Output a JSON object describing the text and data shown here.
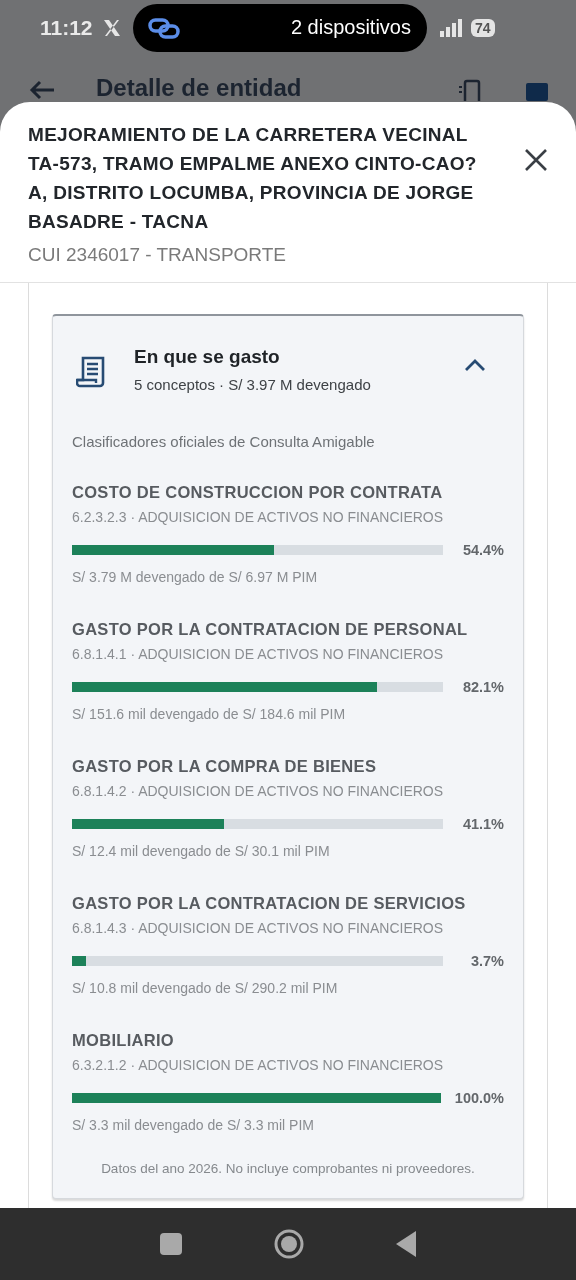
{
  "status_bar": {
    "time": "11:12",
    "pill_text": "2 dispositivos",
    "battery": "74"
  },
  "app_bar": {
    "title": "Detalle de entidad"
  },
  "sheet": {
    "title": "MEJORAMIENTO DE LA CARRETERA VECINAL TA-573, TRAMO EMPALME ANEXO CINTO-CAO?A, DISTRITO LOCUMBA, PROVINCIA DE JORGE BASADRE - TACNA",
    "subtitle": "CUI 2346017 - TRANSPORTE"
  },
  "spend_card": {
    "title": "En que se gasto",
    "summary": "5 conceptos · S/ 3.97 M devengado",
    "expanded": true,
    "caption": "Clasificadores oficiales de Consulta Amigable",
    "concepts": [
      {
        "name": "COSTO DE CONSTRUCCION POR CONTRATA",
        "code": "6.2.3.2.3 · ADQUISICION DE ACTIVOS NO FINANCIEROS",
        "level": 0.544,
        "percent": "54.4%",
        "detail": "S/ 3.79 M devengado de S/ 6.97 M PIM"
      },
      {
        "name": "GASTO POR LA CONTRATACION DE PERSONAL",
        "code": "6.8.1.4.1 · ADQUISICION DE ACTIVOS NO FINANCIEROS",
        "level": 0.821,
        "percent": "82.1%",
        "detail": "S/ 151.6 mil devengado de S/ 184.6 mil PIM"
      },
      {
        "name": "GASTO POR LA COMPRA DE BIENES",
        "code": "6.8.1.4.2 · ADQUISICION DE ACTIVOS NO FINANCIEROS",
        "level": 0.411,
        "percent": "41.1%",
        "detail": "S/ 12.4 mil devengado de S/ 30.1 mil PIM"
      },
      {
        "name": "GASTO POR LA CONTRATACION DE SERVICIOS",
        "code": "6.8.1.4.3 · ADQUISICION DE ACTIVOS NO FINANCIEROS",
        "level": 0.037,
        "percent": "3.7%",
        "detail": "S/ 10.8 mil devengado de S/ 290.2 mil PIM"
      },
      {
        "name": "MOBILIARIO",
        "code": "6.3.2.1.2 · ADQUISICION DE ACTIVOS NO FINANCIEROS",
        "level": 1.0,
        "percent": "100.0%",
        "detail": "S/ 3.3 mil devengado de S/ 3.3 mil PIM"
      }
    ],
    "footnote": "Datos del ano 2026. No incluye comprobantes ni proveedores."
  }
}
